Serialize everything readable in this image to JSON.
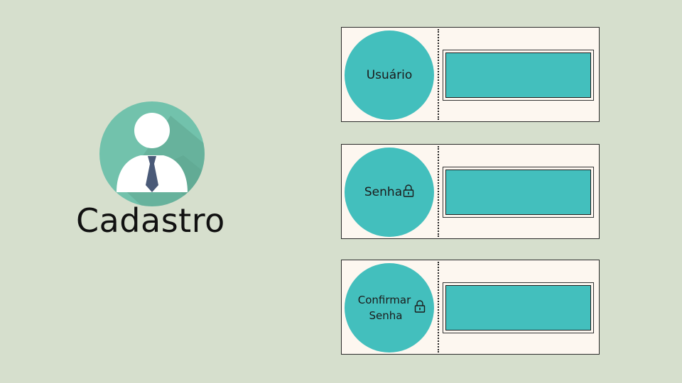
{
  "page": {
    "title": "Cadastro"
  },
  "fields": [
    {
      "label": "Usuário",
      "value": ""
    },
    {
      "label": "Senha",
      "value": ""
    },
    {
      "label_line1": "Confirmar",
      "label_line2": "Senha",
      "value": ""
    }
  ],
  "colors": {
    "background": "#d6dfcd",
    "accent_teal": "#43bfbd",
    "avatar_green": "#72c2ac",
    "card_bg": "#fdf7f0",
    "tie": "#4a5a78"
  },
  "icons": [
    "user-avatar-icon",
    "lock-icon"
  ]
}
